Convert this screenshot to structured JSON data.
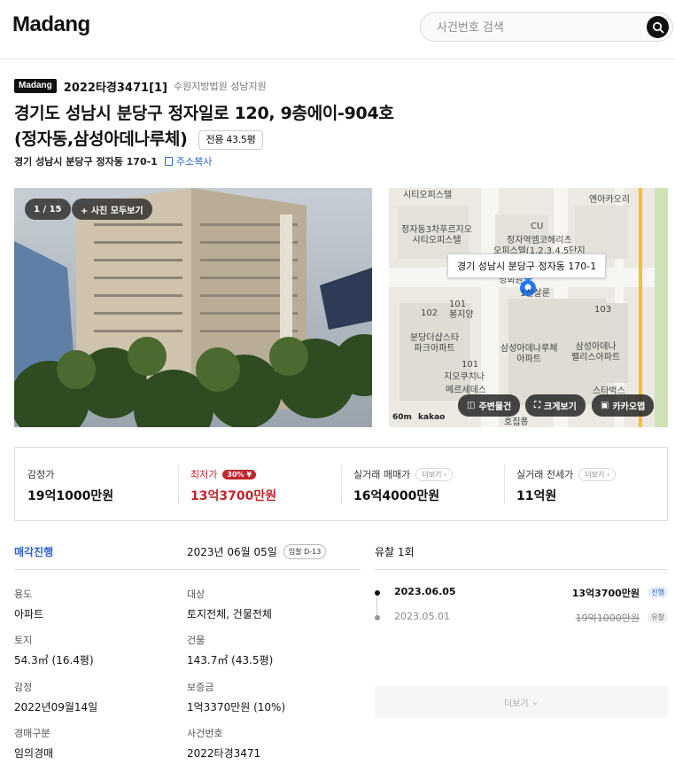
{
  "header": {
    "logo": "Madang",
    "search_placeholder": "사건번호 검색"
  },
  "case": {
    "badge": "Madang",
    "case_number": "2022타경3471[1]",
    "court": "수원지방법원 성남지원",
    "title_line1": "경기도 성남시 분당구 정자일로 120, 9층에이-904호",
    "title_line2": "(정자동,삼성아데나루체)",
    "area_chip": "전용 43.5평",
    "jibun_address": "경기 성남시 분당구 정자동 170-1",
    "copy_label": "주소복사"
  },
  "photo": {
    "counter": "1 / 15",
    "view_all": "+ 사진 모두보기"
  },
  "map": {
    "tooltip": "경기 성남시 분당구 정자동 170-1",
    "labels": {
      "l1": "시티오피스텔",
      "l2": "엔아카오리",
      "l3": "CU",
      "l4": "정자동3차푸르지오\n시티오피스텔",
      "l5": "정자역엠코헤리츠\n오피스텔(1,2,3,4,5단지",
      "l6": "명회원",
      "l7": "1신살룬",
      "l8": "102",
      "l9": "101",
      "l10": "봉지양",
      "l11": "분당더샵스타\n파크아파트",
      "l12": "삼성아데나루체\n아파트",
      "l13": "삼성아데나\n펠리스아파트",
      "l14": "지오쿠치나",
      "l15": "메르세데스",
      "l16": "스타벅스",
      "l17": "103",
      "l18": "101",
      "l19": "호집퐁"
    },
    "scale": "60m",
    "provider": "kakao",
    "buttons": {
      "nearby": "주변물건",
      "enlarge": "크게보기",
      "kakaomap": "카카오맵"
    }
  },
  "prices": {
    "appraisal_label": "감정가",
    "appraisal_value": "19억1000만원",
    "minimum_label": "최저가",
    "minimum_pct": "30%",
    "minimum_value": "13억3700만원",
    "trade_label": "실거래 매매가",
    "trade_more": "더보기",
    "trade_value": "16억4000만원",
    "jeonse_label": "실거래 전세가",
    "jeonse_more": "더보기",
    "jeonse_value": "11억원"
  },
  "info": {
    "status": "매각진행",
    "auction_date": "2023년 06월 05일",
    "dday": "입찰 D-13",
    "usage_label": "용도",
    "usage_value": "아파트",
    "target_label": "대상",
    "target_value": "토지전체, 건물전체",
    "land_label": "토지",
    "land_value": "54.3㎡ (16.4평)",
    "building_label": "건물",
    "building_value": "143.7㎡ (43.5평)",
    "appraisal_label": "감정",
    "appraisal_value": "2022년09월14일",
    "deposit_label": "보증금",
    "deposit_value": "1억3370만원 (10%)",
    "type_label": "경매구분",
    "type_value": "임의경매",
    "caseno_label": "사건번호",
    "caseno_value": "2022타경3471"
  },
  "history": {
    "title": "유찰 1회",
    "rows": [
      {
        "date": "2023.06.05",
        "price": "13억3700만원",
        "status": "진행"
      },
      {
        "date": "2023.05.01",
        "price": "19억1000만원",
        "status": "유찰"
      }
    ],
    "more": "더보기"
  },
  "colors": {
    "accent_blue": "#2b63c9",
    "accent_red": "#c0262d"
  }
}
